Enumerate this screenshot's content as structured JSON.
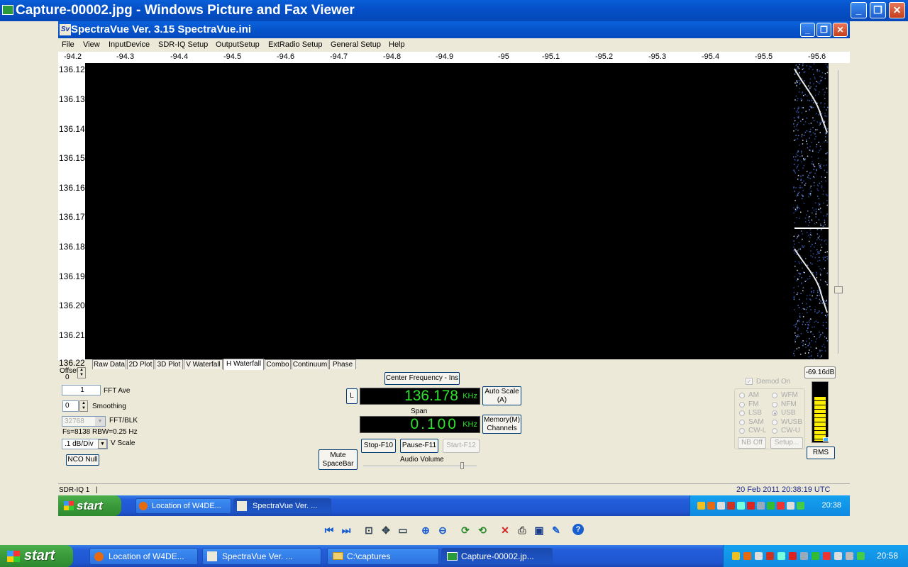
{
  "window": {
    "title": "Capture-00002.jpg - Windows Picture and Fax Viewer",
    "minimize": "_",
    "restore": "❐",
    "close": "✕"
  },
  "spectravue": {
    "title": "SpectraVue Ver. 3.15  SpectraVue.ini",
    "icon_text": "Sv",
    "menu": [
      "File",
      "View",
      "InputDevice",
      "SDR-IQ Setup",
      "OutputSetup",
      "ExtRadio Setup",
      "General Setup",
      "Help"
    ],
    "freq_scale": [
      "-94.2",
      "-94.3",
      "-94.4",
      "-94.5",
      "-94.6",
      "-94.7",
      "-94.8",
      "-94.9",
      "-95",
      "-95.1",
      "-95.2",
      "-95.3",
      "-95.4",
      "-95.5",
      "-95.6"
    ],
    "time_axis": [
      "136.12",
      "136.13",
      "136.14",
      "136.15",
      "136.16",
      "136.17",
      "136.18",
      "136.19",
      "136.20",
      "136.21",
      "136.22"
    ],
    "tabs": [
      "Raw Data",
      "2D Plot",
      "3D Plot",
      "V Waterfall",
      "H Waterfall",
      "Combo",
      "Continuum",
      "Phase"
    ],
    "active_tab": "H Waterfall",
    "offset_label": "Offset",
    "offset_value": "0",
    "fft_ave_value": "1",
    "fft_ave_label": "FFT Ave",
    "smoothing_value": "0",
    "smoothing_label": "Smoothing",
    "fft_blk_value": "32768",
    "fft_blk_label": "FFT/BLK",
    "fs_info": "Fs=8138 RBW=0.25 Hz",
    "vscale_value": ".1 dB/Div",
    "vscale_label": "V Scale",
    "nco_null": "NCO Null",
    "center_freq_button": "Center Frequency - Ins",
    "l_button": "L",
    "center_freq_value": "136.178",
    "center_freq_unit": "KHz",
    "span_label": "Span",
    "span_value": "0.100",
    "span_unit": "KHz",
    "auto_scale_line1": "Auto Scale",
    "auto_scale_line2": "(A)",
    "memory_line1": "Memory(M)",
    "memory_line2": "Channels",
    "mute_line1": "Mute",
    "mute_line2": "SpaceBar",
    "stop": "Stop-F10",
    "pause": "Pause-F11",
    "start": "Start-F12",
    "audio_volume": "Audio Volume",
    "demod_on": "Demod On",
    "modes_left": [
      "AM",
      "FM",
      "LSB",
      "SAM",
      "CW-L"
    ],
    "modes_right": [
      "WFM",
      "NFM",
      "USB",
      "WUSB",
      "CW-U"
    ],
    "selected_mode": "USB",
    "nb_off": "NB Off",
    "setup": "Setup...",
    "level_db": "-69.16dB",
    "rms": "RMS",
    "meter_level": 0.75,
    "status_device": "SDR-IQ 1",
    "status_time": "20 Feb 2011  20:38:19 UTC"
  },
  "inner_taskbar": {
    "start": "start",
    "buttons": [
      "Location of W4DE...",
      "SpectraVue Ver. ..."
    ],
    "clock": "20:38"
  },
  "viewer_toolbar": {
    "icons": [
      "previous-image-icon",
      "next-image-icon",
      "best-fit-icon",
      "actual-size-icon",
      "slideshow-icon",
      "zoom-in-icon",
      "zoom-out-icon",
      "rotate-clockwise-icon",
      "rotate-counterclockwise-icon",
      "delete-icon",
      "print-icon",
      "save-icon",
      "edit-icon",
      "help-icon"
    ]
  },
  "outer_taskbar": {
    "start": "start",
    "buttons": [
      "Location of W4DE...",
      "SpectraVue Ver. ...",
      "C:\\captures",
      "Capture-00002.jp..."
    ],
    "clock": "20:58"
  },
  "colors": {
    "xp_blue": "#245EDB",
    "lcd_green": "#2EE22E",
    "meter_yellow": "#FFEE00"
  }
}
